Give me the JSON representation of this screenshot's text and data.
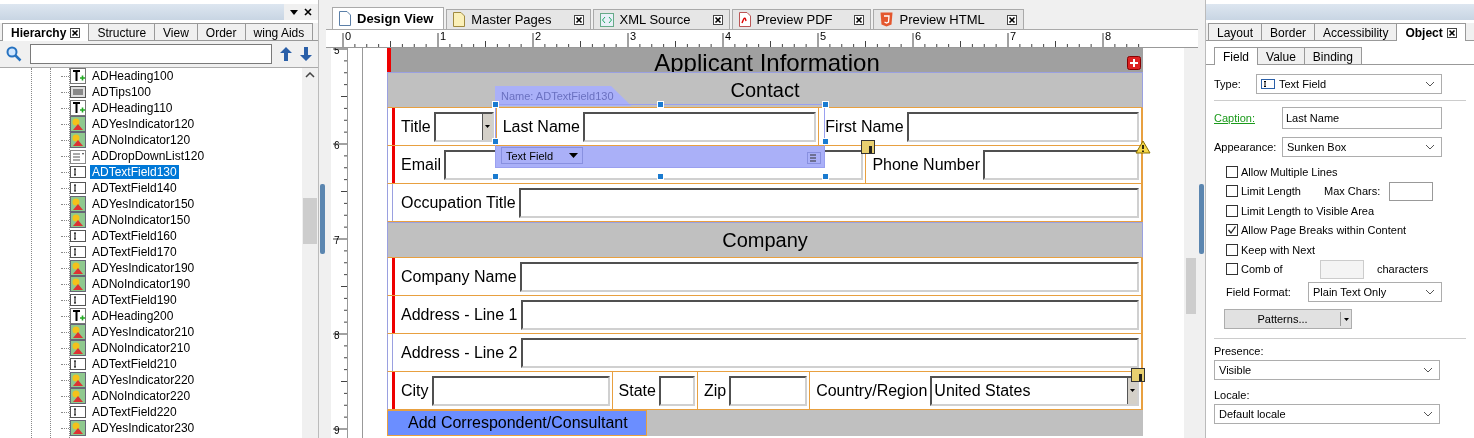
{
  "hierarchy_panel": {
    "tabs": [
      {
        "label": "Hierarchy",
        "selected": true
      },
      {
        "label": "Structure",
        "selected": false
      },
      {
        "label": "View",
        "selected": false
      },
      {
        "label": "Order",
        "selected": false
      },
      {
        "label": "wing Aids",
        "selected": false
      }
    ],
    "tree": [
      {
        "label": "ADHeading100",
        "kind": "heading",
        "selected": false
      },
      {
        "label": "ADTips100",
        "kind": "tips",
        "selected": false
      },
      {
        "label": "ADHeading110",
        "kind": "heading",
        "selected": false
      },
      {
        "label": "ADYesIndicator120",
        "kind": "indicator",
        "selected": false
      },
      {
        "label": "ADNoIndicator120",
        "kind": "indicator",
        "selected": false
      },
      {
        "label": "ADDropDownList120",
        "kind": "dropdown",
        "selected": false
      },
      {
        "label": "ADTextField130",
        "kind": "textfield",
        "selected": true
      },
      {
        "label": "ADTextField140",
        "kind": "textfield",
        "selected": false
      },
      {
        "label": "ADYesIndicator150",
        "kind": "indicator",
        "selected": false
      },
      {
        "label": "ADNoIndicator150",
        "kind": "indicator",
        "selected": false
      },
      {
        "label": "ADTextField160",
        "kind": "textfield",
        "selected": false
      },
      {
        "label": "ADTextField170",
        "kind": "textfield",
        "selected": false
      },
      {
        "label": "ADYesIndicator190",
        "kind": "indicator",
        "selected": false
      },
      {
        "label": "ADNoIndicator190",
        "kind": "indicator",
        "selected": false
      },
      {
        "label": "ADTextField190",
        "kind": "textfield",
        "selected": false
      },
      {
        "label": "ADHeading200",
        "kind": "heading",
        "selected": false
      },
      {
        "label": "ADYesIndicator210",
        "kind": "indicator",
        "selected": false
      },
      {
        "label": "ADNoIndicator210",
        "kind": "indicator",
        "selected": false
      },
      {
        "label": "ADTextField210",
        "kind": "textfield",
        "selected": false
      },
      {
        "label": "ADYesIndicator220",
        "kind": "indicator",
        "selected": false
      },
      {
        "label": "ADNoIndicator220",
        "kind": "indicator",
        "selected": false
      },
      {
        "label": "ADTextField220",
        "kind": "textfield",
        "selected": false
      },
      {
        "label": "ADYesIndicator230",
        "kind": "indicator",
        "selected": false
      }
    ]
  },
  "editor": {
    "tabs": [
      {
        "label": "Design View",
        "kind": "page",
        "selected": true
      },
      {
        "label": "Master Pages",
        "kind": "master",
        "selected": false
      },
      {
        "label": "XML Source",
        "kind": "xml",
        "selected": false
      },
      {
        "label": "Preview PDF",
        "kind": "pdf",
        "selected": false
      },
      {
        "label": "Preview HTML",
        "kind": "html",
        "selected": false
      }
    ],
    "h_ruler": [
      "0",
      "1",
      "2",
      "3",
      "4",
      "5",
      "6",
      "7",
      "8"
    ],
    "v_ruler": [
      "5",
      "6",
      "7",
      "8",
      "9"
    ],
    "form": {
      "heading": "Applicant Information",
      "sections": [
        {
          "title": "Contact",
          "rows": [
            {
              "required": true,
              "cells": [
                {
                  "caption": "Title",
                  "kind": "dropdown"
                },
                {
                  "caption": "Last Name",
                  "kind": "text"
                },
                {
                  "caption": "First Name",
                  "kind": "text"
                }
              ]
            },
            {
              "required": true,
              "cells": [
                {
                  "caption": "Email",
                  "kind": "text"
                },
                {
                  "caption": "Phone Number",
                  "kind": "text"
                }
              ]
            },
            {
              "required": false,
              "cells": [
                {
                  "caption": "Occupation Title",
                  "kind": "text"
                }
              ]
            }
          ]
        },
        {
          "title": "Company",
          "rows": [
            {
              "required": true,
              "cells": [
                {
                  "caption": "Company Name",
                  "kind": "text"
                }
              ]
            },
            {
              "required": true,
              "cells": [
                {
                  "caption": "Address - Line 1",
                  "kind": "text"
                }
              ]
            },
            {
              "required": false,
              "cells": [
                {
                  "caption": "Address - Line 2",
                  "kind": "text"
                }
              ]
            },
            {
              "required": true,
              "cells": [
                {
                  "caption": "City",
                  "kind": "text"
                },
                {
                  "caption": "State",
                  "kind": "text"
                },
                {
                  "caption": "Zip",
                  "kind": "text"
                },
                {
                  "caption": "Country/Region",
                  "kind": "dropdown",
                  "value": "United States"
                }
              ]
            }
          ]
        }
      ],
      "add_button": "Add Correspondent/Consultant",
      "selection": {
        "name_tag": "Name: ADTextField130",
        "type_menu": "Text Field"
      }
    }
  },
  "object_panel": {
    "tabs": [
      {
        "label": "Layout",
        "selected": false
      },
      {
        "label": "Border",
        "selected": false
      },
      {
        "label": "Accessibility",
        "selected": false
      },
      {
        "label": "Object",
        "selected": true
      }
    ],
    "subtabs": [
      {
        "label": "Field",
        "selected": true
      },
      {
        "label": "Value",
        "selected": false
      },
      {
        "label": "Binding",
        "selected": false
      }
    ],
    "type": {
      "label": "Type:",
      "value": "Text Field"
    },
    "caption": {
      "label": "Caption:",
      "value": "Last Name"
    },
    "appearance": {
      "label": "Appearance:",
      "value": "Sunken Box"
    },
    "options": [
      {
        "kind": "plain",
        "label": "Allow Multiple Lines",
        "checked": false
      },
      {
        "kind": "maxchars",
        "label": "Limit Length",
        "extra": "Max Chars:",
        "checked": false
      },
      {
        "kind": "plain",
        "label": "Limit Length to Visible Area",
        "checked": false
      },
      {
        "kind": "plain",
        "label": "Allow Page Breaks within Content",
        "checked": true
      },
      {
        "kind": "plain",
        "label": "Keep with Next",
        "checked": false
      },
      {
        "kind": "comb",
        "label": "Comb of",
        "extra": "characters",
        "checked": false
      }
    ],
    "field_format": {
      "label": "Field Format:",
      "value": "Plain Text Only"
    },
    "patterns_button": "Patterns...",
    "presence": {
      "label": "Presence:",
      "value": "Visible"
    },
    "locale": {
      "label": "Locale:",
      "value": "Default locale"
    }
  }
}
